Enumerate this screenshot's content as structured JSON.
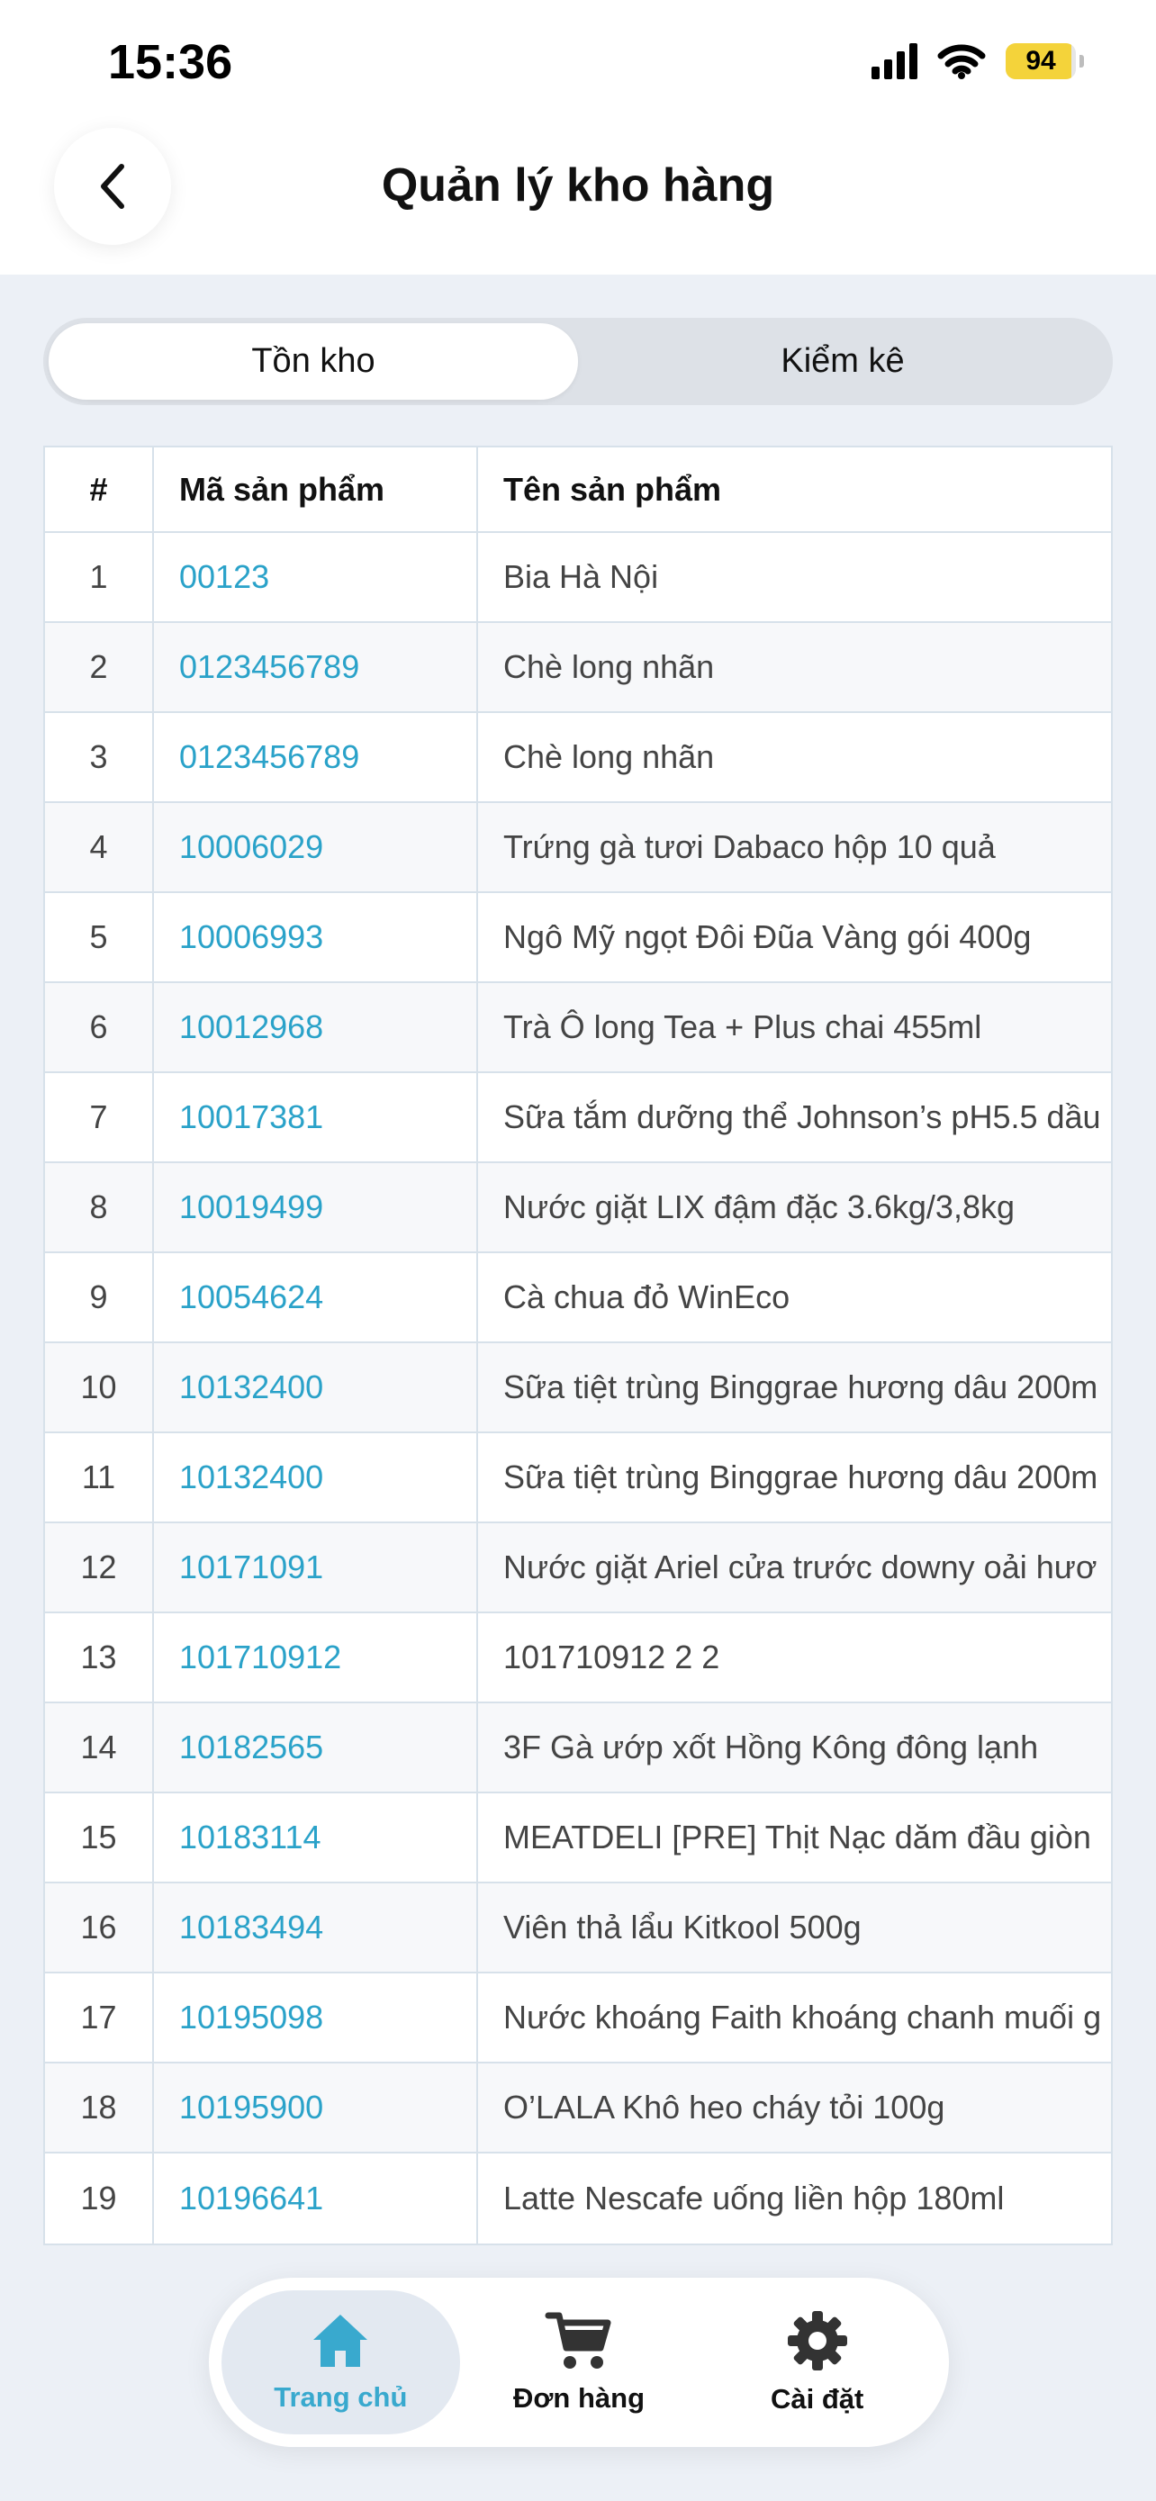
{
  "status_bar": {
    "time": "15:36",
    "battery": "94",
    "battery_level_percent": 94
  },
  "header": {
    "title": "Quản lý kho hàng"
  },
  "tabs": [
    {
      "label": "Tồn kho",
      "active": true
    },
    {
      "label": "Kiểm kê",
      "active": false
    }
  ],
  "table": {
    "columns": [
      "#",
      "Mã sản phẩm",
      "Tên sản phẩm"
    ],
    "rows": [
      {
        "no": "1",
        "code": "00123",
        "name": "Bia Hà Nội"
      },
      {
        "no": "2",
        "code": "0123456789",
        "name": "Chè long nhãn"
      },
      {
        "no": "3",
        "code": "0123456789",
        "name": "Chè long nhãn"
      },
      {
        "no": "4",
        "code": "10006029",
        "name": "Trứng gà tươi Dabaco hộp 10 quả"
      },
      {
        "no": "5",
        "code": "10006993",
        "name": "Ngô Mỹ ngọt Đôi Đũa Vàng gói 400g"
      },
      {
        "no": "6",
        "code": "10012968",
        "name": "Trà Ô long Tea + Plus chai 455ml"
      },
      {
        "no": "7",
        "code": "10017381",
        "name": "Sữa tắm dưỡng thể Johnson’s pH5.5 dầu"
      },
      {
        "no": "8",
        "code": "10019499",
        "name": "Nước giặt LIX đậm đặc 3.6kg/3,8kg"
      },
      {
        "no": "9",
        "code": "10054624",
        "name": "Cà chua đỏ WinEco"
      },
      {
        "no": "10",
        "code": "10132400",
        "name": "Sữa tiệt trùng Binggrae hương dâu 200m"
      },
      {
        "no": "11",
        "code": "10132400",
        "name": "Sữa tiệt trùng Binggrae hương dâu 200m"
      },
      {
        "no": "12",
        "code": "10171091",
        "name": "Nước giặt Ariel cửa trước downy oải hươ"
      },
      {
        "no": "13",
        "code": "101710912",
        "name": "101710912 2 2"
      },
      {
        "no": "14",
        "code": "10182565",
        "name": "3F Gà ướp xốt Hồng Kông đông lạnh"
      },
      {
        "no": "15",
        "code": "10183114",
        "name": "MEATDELI [PRE] Thịt Nạc dăm đầu giòn"
      },
      {
        "no": "16",
        "code": "10183494",
        "name": "Viên thả lẩu Kitkool 500g"
      },
      {
        "no": "17",
        "code": "10195098",
        "name": "Nước khoáng Faith khoáng chanh muối g"
      },
      {
        "no": "18",
        "code": "10195900",
        "name": "O’LALA Khô heo cháy tỏi 100g"
      },
      {
        "no": "19",
        "code": "10196641",
        "name": "Latte Nescafe uống liền hộp 180ml"
      }
    ]
  },
  "bottom_nav": {
    "items": [
      {
        "label": "Trang chủ",
        "icon": "home-icon",
        "active": true
      },
      {
        "label": "Đơn hàng",
        "icon": "cart-icon",
        "active": false
      },
      {
        "label": "Cài đặt",
        "icon": "gear-icon",
        "active": false
      }
    ]
  },
  "colors": {
    "accent": "#39A9CE",
    "link": "#2AA2C9",
    "background": "#ECF0F6"
  }
}
